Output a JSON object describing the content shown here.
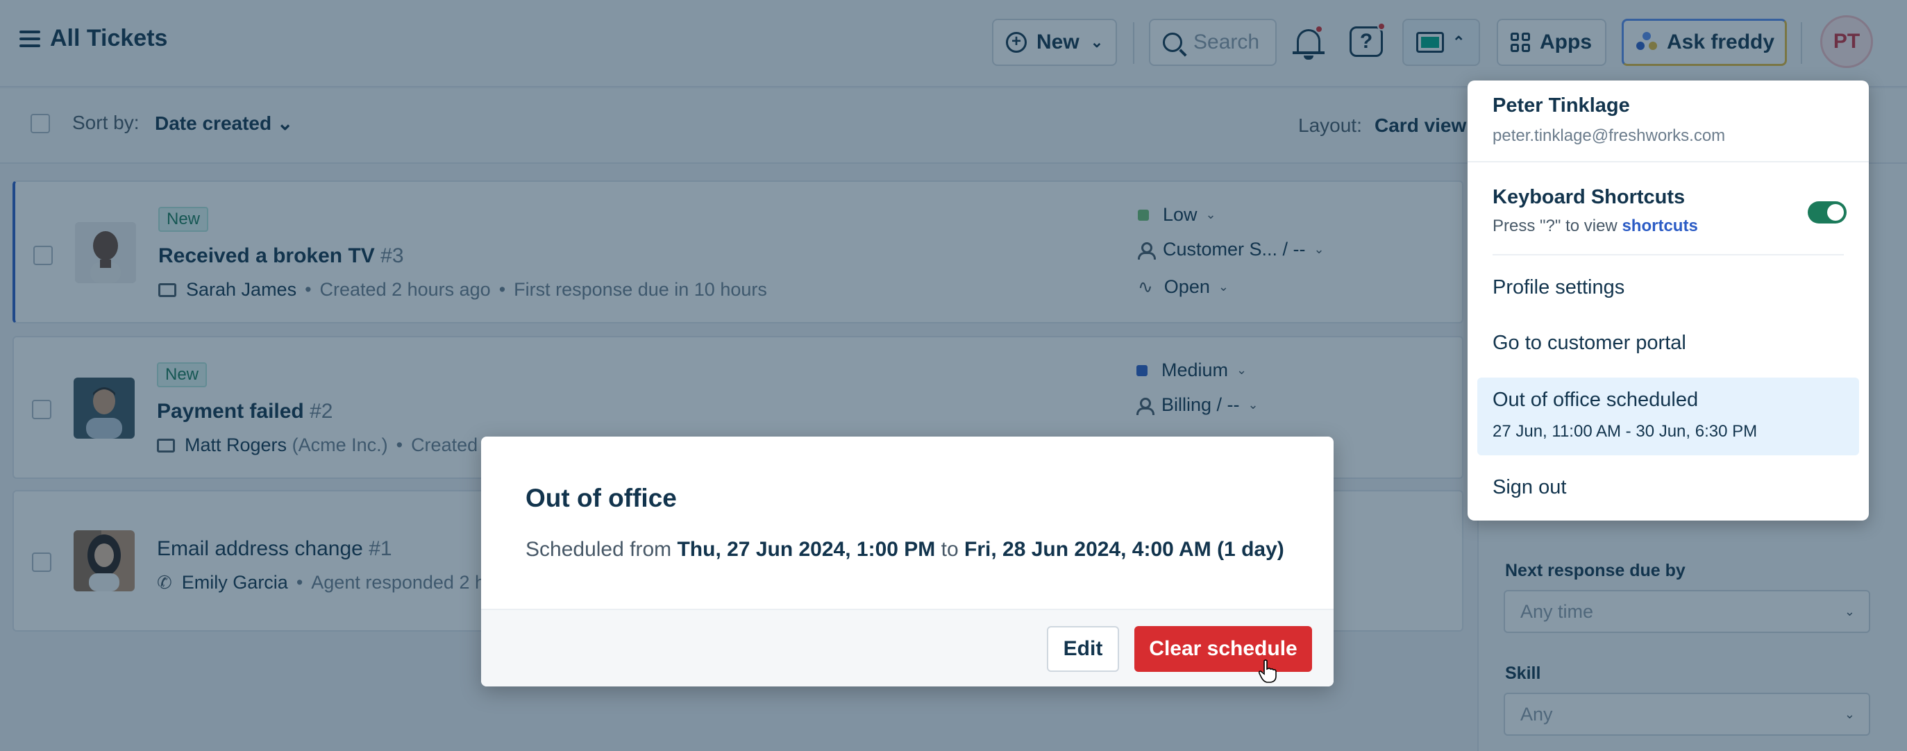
{
  "header": {
    "title": "All Tickets",
    "new_label": "New",
    "search_placeholder": "Search",
    "help_glyph": "?",
    "apps_label": "Apps",
    "freddy_label": "Ask freddy",
    "avatar_initials": "PT",
    "accent_color": "#c82f3c"
  },
  "toolbar": {
    "sort_label": "Sort by:",
    "sort_value": "Date created",
    "layout_label": "Layout:",
    "layout_value": "Card view"
  },
  "tickets": [
    {
      "badge": "New",
      "title": "Received a broken TV",
      "number": "#3",
      "contact": "Sarah James",
      "contact_extra": "",
      "created": "Created 2 hours ago",
      "due": "First response due in 10 hours",
      "channel_icon": "mail-icon",
      "priority": "Low",
      "priority_color": "#6fbf73",
      "group": "Customer S... / --",
      "status": "Open"
    },
    {
      "badge": "New",
      "title": "Payment failed",
      "number": "#2",
      "contact": "Matt Rogers",
      "contact_extra": "(Acme Inc.)",
      "created": "Created",
      "channel_icon": "mail-icon",
      "priority": "Medium",
      "priority_color": "#2c5cc5",
      "group": "Billing / --"
    },
    {
      "title": "Email address change",
      "number": "#1",
      "contact": "Emily Garcia",
      "activity": "Agent responded 2 h",
      "channel_icon": "phone-icon"
    }
  ],
  "filters": {
    "next_response_label": "Next response due by",
    "next_response_value": "Any time",
    "skill_label": "Skill",
    "skill_value": "Any"
  },
  "profile_menu": {
    "name": "Peter Tinklage",
    "email": "peter.tinklage@freshworks.com",
    "shortcuts_title": "Keyboard Shortcuts",
    "shortcuts_hint_prefix": "Press \"?\" to view",
    "shortcuts_hint_link": "shortcuts",
    "shortcuts_enabled": true,
    "profile_settings": "Profile settings",
    "customer_portal": "Go to customer portal",
    "ooo_title": "Out of office scheduled",
    "ooo_range": "27 Jun, 11:00 AM - 30 Jun, 6:30 PM",
    "sign_out": "Sign out"
  },
  "modal": {
    "title": "Out of office",
    "text_prefix": "Scheduled from",
    "start": "Thu, 27 Jun 2024, 1:00 PM",
    "text_mid": "to",
    "end": "Fri, 28 Jun 2024, 4:00 AM",
    "duration": "(1 day)",
    "edit_label": "Edit",
    "clear_label": "Clear schedule",
    "clear_color": "#d72d30"
  }
}
